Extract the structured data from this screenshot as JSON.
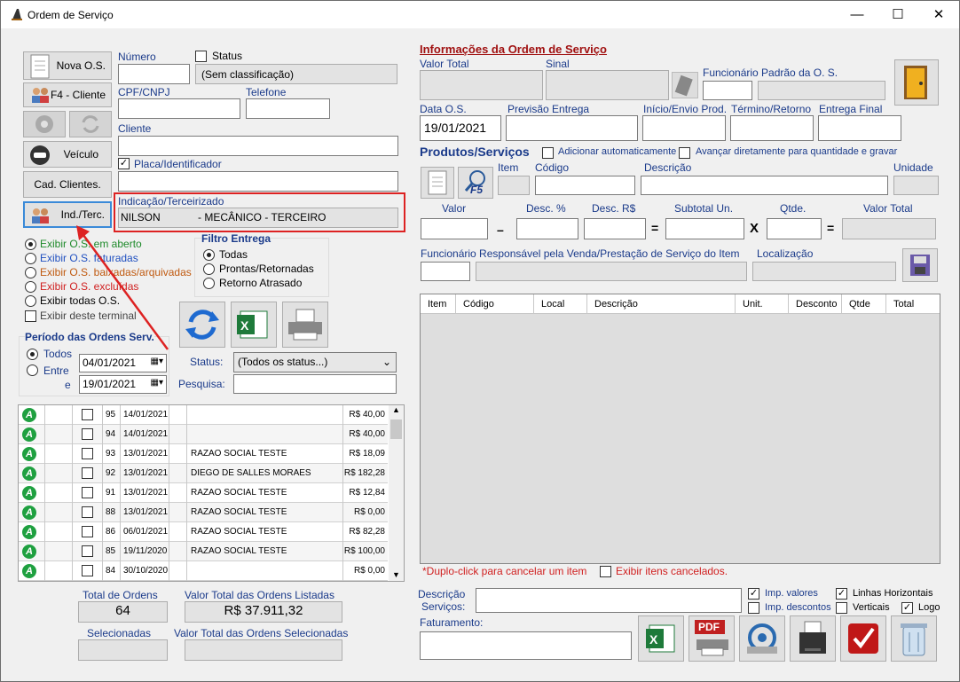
{
  "window": {
    "title": "Ordem de Serviço",
    "minimize": "—",
    "maximize": "☐",
    "close": "✕"
  },
  "left": {
    "buttons": {
      "nova_os": "Nova O.S.",
      "cliente": "F4 - Cliente",
      "veiculo": "Veículo",
      "cad_clientes": "Cad. Clientes.",
      "ind_terc": "Ind./Terc."
    },
    "numero_label": "Número",
    "status_label": "Status",
    "status_value": "(Sem classificação)",
    "cpf_label": "CPF/CNPJ",
    "telefone_label": "Telefone",
    "cliente_label": "Cliente",
    "placa_label": "Placa/Identificador",
    "indicacao_label": "Indicação/Terceirizado",
    "indicacao_value_a": "NILSON",
    "indicacao_value_b": "- MECÂNICO - TERCEIRO",
    "filters": {
      "aberto": "Exibir O.S. em aberto",
      "faturadas": "Exibir O.S. faturadas",
      "baixadas": "Exibir O.S. baixadas/arquivadas",
      "excluidas": "Exibir O.S. excluídas",
      "todas": "Exibir todas O.S.",
      "terminal": "Exibir deste terminal"
    },
    "filtro_entrega": {
      "title": "Filtro Entrega",
      "todas": "Todas",
      "prontas": "Prontas/Retornadas",
      "retorno": "Retorno Atrasado"
    },
    "periodo": {
      "title": "Período das Ordens Serv.",
      "todos": "Todos",
      "entre": "Entre",
      "e": "e",
      "date_from": "04/01/2021",
      "date_to": "19/01/2021"
    },
    "status_filter_label": "Status:",
    "status_filter_value": "(Todos os status...)",
    "pesquisa_label": "Pesquisa:",
    "rows": [
      {
        "num": "95",
        "date": "14/01/2021",
        "name": "",
        "value": "R$ 40,00"
      },
      {
        "num": "94",
        "date": "14/01/2021",
        "name": "",
        "value": "R$ 40,00"
      },
      {
        "num": "93",
        "date": "13/01/2021",
        "name": "RAZAO SOCIAL TESTE",
        "value": "R$ 18,09"
      },
      {
        "num": "92",
        "date": "13/01/2021",
        "name": "DIEGO DE SALLES MORAES",
        "value": "R$ 182,28"
      },
      {
        "num": "91",
        "date": "13/01/2021",
        "name": "RAZAO SOCIAL TESTE",
        "value": "R$ 12,84"
      },
      {
        "num": "88",
        "date": "13/01/2021",
        "name": "RAZAO SOCIAL TESTE",
        "value": "R$ 0,00"
      },
      {
        "num": "86",
        "date": "06/01/2021",
        "name": "RAZAO SOCIAL TESTE",
        "value": "R$ 82,28"
      },
      {
        "num": "85",
        "date": "19/11/2020",
        "name": "RAZAO SOCIAL TESTE",
        "value": "R$ 100,00"
      },
      {
        "num": "84",
        "date": "30/10/2020",
        "name": "",
        "value": "R$ 0,00"
      }
    ],
    "totals": {
      "total_ordens_label": "Total de Ordens",
      "total_ordens_value": "64",
      "valor_total_label": "Valor Total das Ordens Listadas",
      "valor_total_value": "R$ 37.911,32",
      "selecionadas_label": "Selecionadas",
      "valor_sel_label": "Valor Total das Ordens Selecionadas"
    }
  },
  "right": {
    "title": "Informações da Ordem de Serviço",
    "valor_total": "Valor Total",
    "sinal": "Sinal",
    "funcionario_padrao": "Funcionário Padrão da O. S.",
    "data_os": "Data O.S.",
    "data_os_value": "19/01/2021",
    "previsao": "Previsão Entrega",
    "inicio": "Início/Envio Prod.",
    "termino": "Término/Retorno",
    "entrega_final": "Entrega Final",
    "produtos_title": "Produtos/Serviços",
    "add_auto": "Adicionar automaticamente",
    "avancar": "Avançar diretamente para quantidade e gravar",
    "item": "Item",
    "codigo": "Código",
    "descricao": "Descrição",
    "unidade": "Unidade",
    "valor": "Valor",
    "desc_pct": "Desc. %",
    "desc_rs": "Desc. R$",
    "subtotal": "Subtotal Un.",
    "qtde": "Qtde.",
    "valor_total_item": "Valor Total",
    "minus": "–",
    "eq": "=",
    "x": "X",
    "func_resp": "Funcionário Responsável pela Venda/Prestação de Serviço do Item",
    "localizacao": "Localização",
    "grid_headers": [
      "Item",
      "Código",
      "Local",
      "Descrição",
      "Unit.",
      "Desconto",
      "Qtde",
      "Total"
    ],
    "duplo_click": "*Duplo-click para cancelar um item",
    "exibir_cancelados": "Exibir itens cancelados.",
    "descricao_servicos": "Descrição\nServiços:",
    "imp_valores": "Imp. valores",
    "imp_descontos": "Imp. descontos",
    "linhas_h": "Linhas Horizontais",
    "verticais": "Verticais",
    "logo": "Logo",
    "faturamento": "Faturamento:",
    "f5": "F5",
    "pdf": "PDF"
  }
}
